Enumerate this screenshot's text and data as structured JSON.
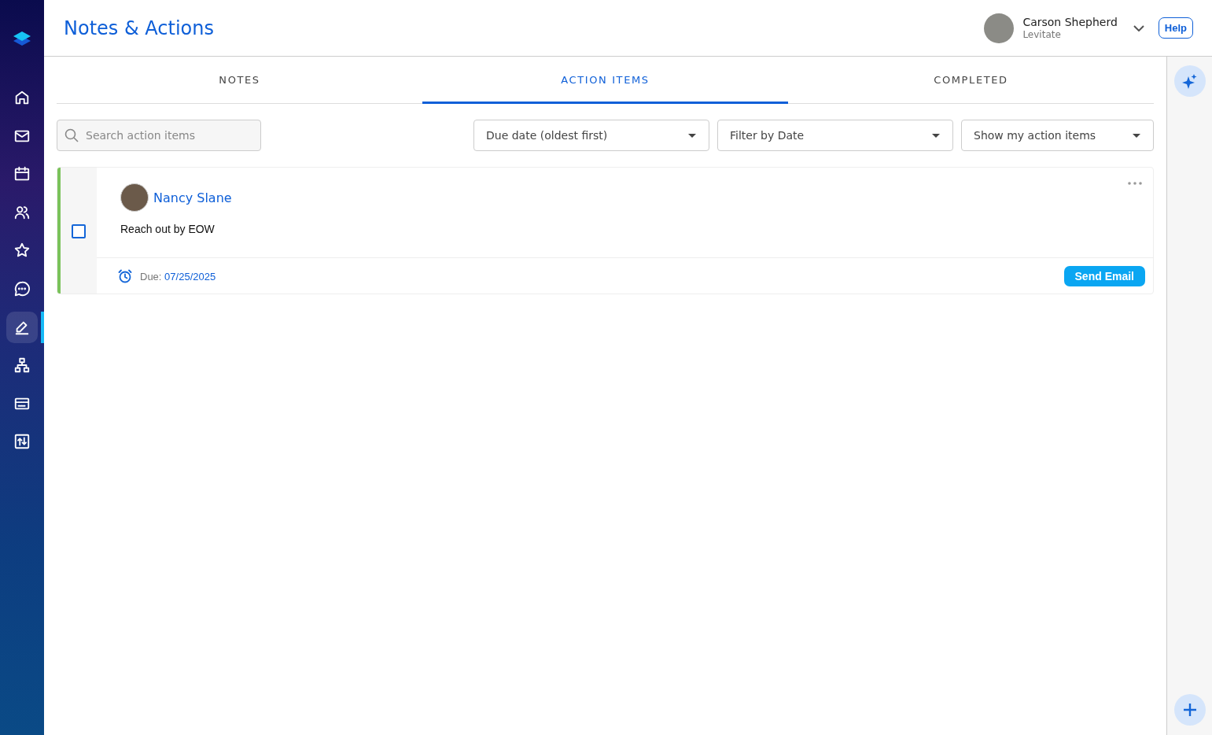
{
  "sidebar": {
    "nav_items": [
      {
        "selected": false
      },
      {
        "selected": false
      },
      {
        "selected": false
      },
      {
        "selected": false
      },
      {
        "selected": false
      },
      {
        "selected": false
      },
      {
        "selected": true
      },
      {
        "selected": false
      },
      {
        "selected": false
      },
      {
        "selected": false
      }
    ]
  },
  "header": {
    "title": "Notes & Actions",
    "user": {
      "name": "Carson Shepherd",
      "company": "Levitate"
    },
    "help": "Help"
  },
  "tabs": [
    {
      "label": "NOTES",
      "selected": false
    },
    {
      "label": "ACTION ITEMS",
      "selected": true
    },
    {
      "label": "COMPLETED",
      "selected": false
    }
  ],
  "search": {
    "placeholder": "Search action items"
  },
  "filters": [
    {
      "value": "Due date (oldest first)"
    },
    {
      "value": "Filter by Date"
    },
    {
      "value": "Show my action items"
    }
  ],
  "action_items": [
    {
      "contact": "Nancy Slane",
      "text": "Reach out by EOW",
      "checked": false,
      "color": "#7ac25a",
      "due_label": "Due:",
      "due_date": "07/25/2025",
      "button": "Send Email"
    }
  ]
}
